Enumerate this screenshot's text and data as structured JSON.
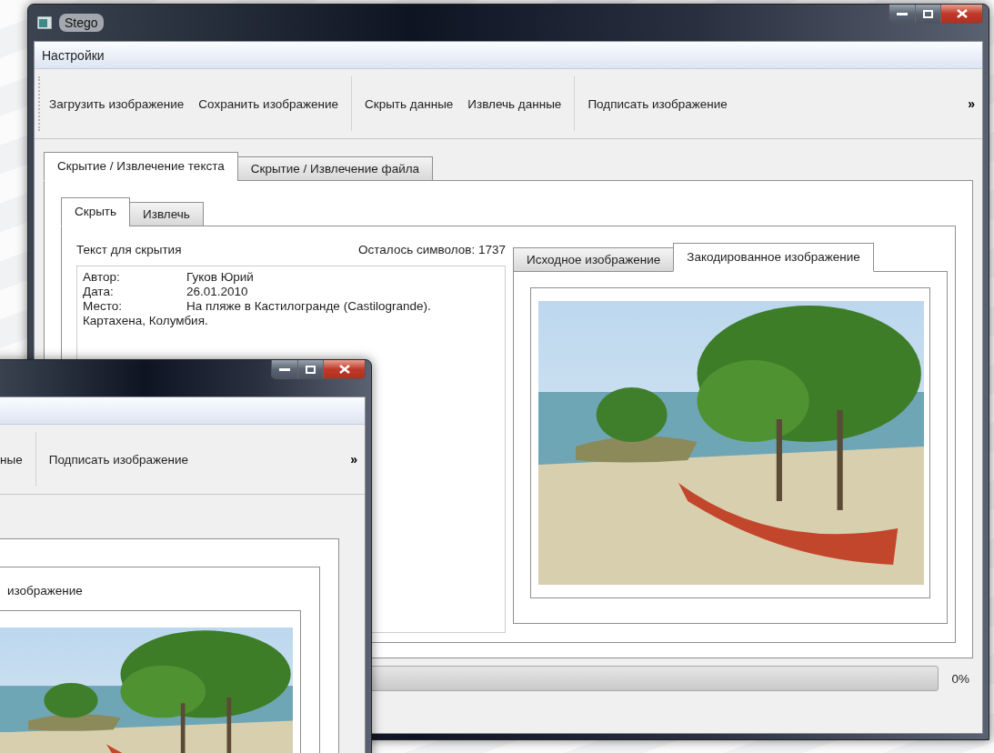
{
  "main_window": {
    "title": "Stego",
    "menu": [
      {
        "label": "Настройки"
      }
    ],
    "toolbar_groups": [
      [
        "Загрузить изображение",
        "Сохранить изображение"
      ],
      [
        "Скрыть данные",
        "Извлечь данные"
      ],
      [
        "Подписать изображение"
      ]
    ],
    "toolbar_overflow": "»",
    "tabs": [
      {
        "label": "Скрытие / Извлечение текста",
        "selected": true
      },
      {
        "label": "Скрытие / Извлечение файла",
        "selected": false
      }
    ],
    "subtabs": [
      {
        "label": "Скрыть",
        "selected": true
      },
      {
        "label": "Извлечь",
        "selected": false
      }
    ],
    "text_label": "Текст для скрытия",
    "chars_left": "Осталось символов: 1737",
    "text_lines": [
      {
        "kind": "field",
        "label": "Автор:",
        "value": "Гуков Юрий"
      },
      {
        "kind": "field",
        "label": "Дата:",
        "value": "26.01.2010"
      },
      {
        "kind": "field",
        "label": "Место:",
        "value": "На пляже в Кастилогранде (Castilogrande)."
      },
      {
        "kind": "line",
        "text": "Картахена, Колумбия."
      }
    ],
    "image_tabs": [
      {
        "label": "Исходное изображение",
        "selected": false
      },
      {
        "label": "Закодированное изображение",
        "selected": true
      }
    ],
    "progress": {
      "level": 0,
      "reading": "0%"
    }
  },
  "front_window": {
    "toolbar_groups": [
      [
        "ные"
      ],
      [
        "Подписать изображение"
      ]
    ],
    "toolbar_overflow": "»",
    "tab_label": "изображение"
  }
}
